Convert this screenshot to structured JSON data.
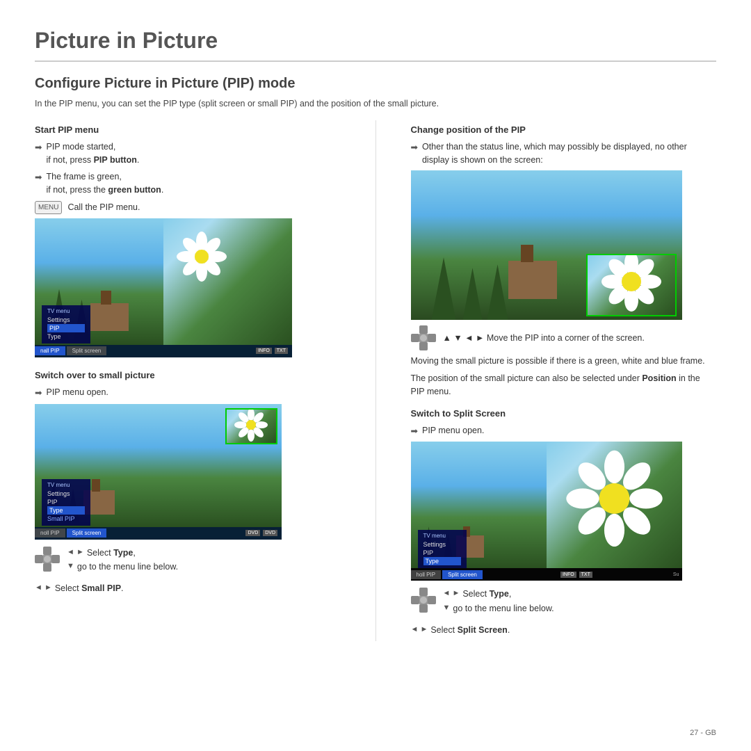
{
  "page": {
    "title": "Picture in Picture",
    "section_title": "Configure Picture in Picture (PIP) mode",
    "intro": "In the PIP menu, you can set the PIP type (split screen or small PIP) and the position of the small picture.",
    "page_number": "27 - GB"
  },
  "left_column": {
    "start_pip_menu": {
      "title": "Start PIP menu",
      "bullets": [
        "PIP mode started, if not, press PIP button.",
        "The frame is green, if not, press the green button."
      ],
      "call_pip": "Call the PIP menu."
    },
    "switch_over": {
      "title": "Switch over to small picture",
      "pip_menu_open": "PIP menu open.",
      "select_type_label": "Select Type,",
      "select_type_sub": "go to the menu line below.",
      "select_small_pip": "Select Small PIP."
    }
  },
  "right_column": {
    "change_position": {
      "title": "Change position of the PIP",
      "bullet": "Other than the status line, which may possibly be displayed, no other display is shown on the screen:",
      "move_label": "▲ ▼ ◄ ► Move the PIP into a corner of the screen.",
      "note1": "Moving the small picture is possible if there is a green, white and blue frame.",
      "note2": "The position of the small picture can also be selected under Position in the PIP menu."
    },
    "switch_split": {
      "title": "Switch to Split Screen",
      "pip_menu_open": "PIP menu open.",
      "select_type_label": "Select Type,",
      "select_type_sub": "go to the menu line below.",
      "select_split": "Select Split Screen."
    }
  },
  "tv_menu": {
    "title": "TV menu",
    "items": [
      "Settings",
      "PIP",
      "Type"
    ],
    "bottom_tabs": [
      "nall PIP",
      "Split screen"
    ],
    "info_tags": [
      "INFO",
      "TXT"
    ]
  },
  "icons": {
    "menu_button": "MENU",
    "pip_button": "PIP",
    "green_button": "green button",
    "dpad": "directional-pad"
  }
}
